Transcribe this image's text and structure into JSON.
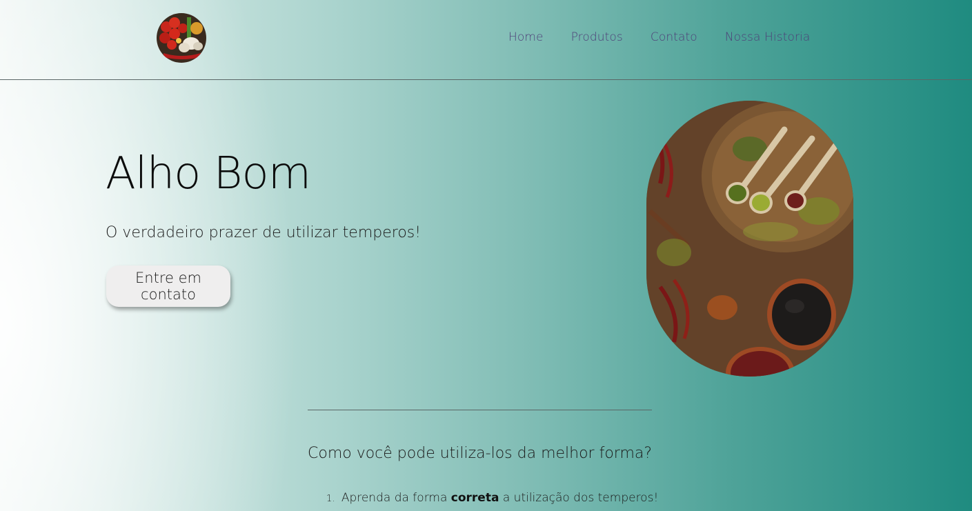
{
  "nav": {
    "items": [
      {
        "label": "Home"
      },
      {
        "label": "Produtos"
      },
      {
        "label": "Contato"
      },
      {
        "label": "Nossa Historia"
      }
    ]
  },
  "hero": {
    "title": "Alho Bom",
    "subtitle": "O verdadeiro prazer de utilizar temperos!",
    "cta_label": "Entre em contato"
  },
  "section": {
    "title": "Como você pode utiliza-los da melhor forma?",
    "list": [
      {
        "number": "1.",
        "text_before": "Aprenda da forma",
        "text_strong": "correta",
        "text_after": "a utilização dos temperos!"
      }
    ]
  },
  "images": {
    "logo": "vegetables-logo-image",
    "hero": "spices-on-wooden-board-image"
  },
  "colors": {
    "nav_link": "#4e3f78",
    "gradient_start": "#eef5f3",
    "gradient_end": "#1f8b80",
    "button_bg": "#efeeee"
  }
}
